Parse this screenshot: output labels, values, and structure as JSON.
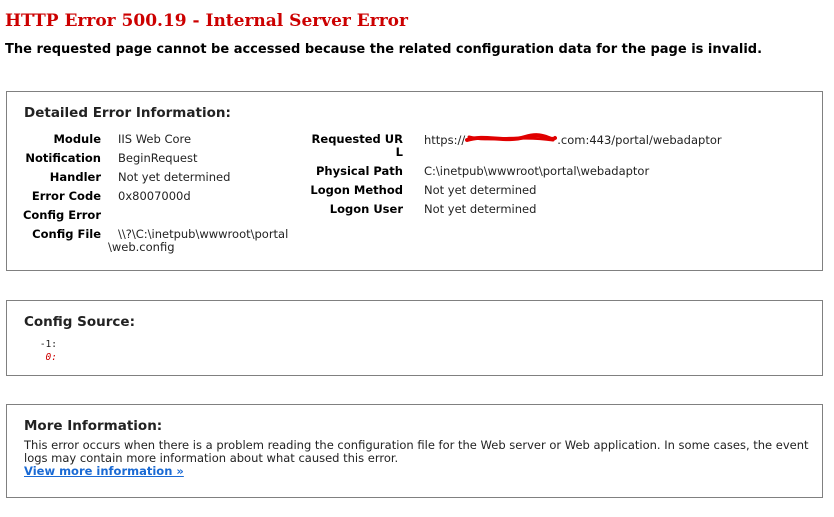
{
  "error": {
    "title": "HTTP Error 500.19 - Internal Server Error",
    "subtitle": "The requested page cannot be accessed because the related configuration data for the page is invalid."
  },
  "detailed": {
    "heading": "Detailed Error Information:",
    "left": [
      {
        "label": "Module",
        "value": "IIS Web Core"
      },
      {
        "label": "Notification",
        "value": "BeginRequest"
      },
      {
        "label": "Handler",
        "value": "Not yet determined"
      },
      {
        "label": "Error Code",
        "value": "0x8007000d"
      },
      {
        "label": "Config Error",
        "value": ""
      },
      {
        "label": "Config File",
        "value_line1": "\\\\?\\C:\\inetpub\\wwwroot\\portal",
        "value_line2": "\\web.config"
      }
    ],
    "requested_url": {
      "label_line1": "Requested UR",
      "label_line2": "L",
      "prefix": "https://",
      "suffix": ".com:443/portal/webadaptor"
    },
    "right": [
      {
        "label": "Physical Path",
        "value": "C:\\inetpub\\wwwroot\\portal\\webadaptor"
      },
      {
        "label": "Logon Method",
        "value": "Not yet determined"
      },
      {
        "label": "Logon User",
        "value": "Not yet determined"
      }
    ]
  },
  "config_source": {
    "heading": "Config Source:",
    "lines": [
      {
        "num": "-1:",
        "color": "#222222"
      },
      {
        "num": "0:",
        "color": "#cc0000"
      }
    ]
  },
  "more_info": {
    "heading": "More Information:",
    "text": "This error occurs when there is a problem reading the configuration file for the Web server or Web application. In some cases, the event logs may contain more information about what caused this error.",
    "link": "View more information »"
  },
  "colors": {
    "error_title": "#cc0000",
    "link": "#1a6ad4",
    "redaction": "#e00000"
  }
}
